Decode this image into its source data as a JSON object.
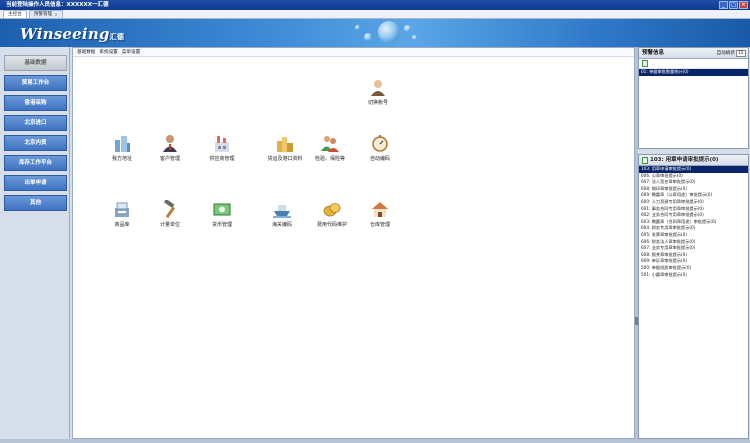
{
  "window": {
    "title": "当前登陆操作人员信息：XXXXXX一汇德"
  },
  "tabs": [
    {
      "label": "主控台",
      "active": true,
      "closable": false
    },
    {
      "label": "预警管理",
      "active": false,
      "closable": true
    }
  ],
  "brand": {
    "logo_text": "Winseeing",
    "logo_suffix": "汇德"
  },
  "sidebar": {
    "items": [
      {
        "label": "基础数据",
        "style": "grey"
      },
      {
        "label": "贸易工作台",
        "style": "blue"
      },
      {
        "label": "香港采购",
        "style": "blue"
      },
      {
        "label": "北京进口",
        "style": "blue"
      },
      {
        "label": "北京内贸",
        "style": "blue"
      },
      {
        "label": "库存工作平台",
        "style": "blue"
      },
      {
        "label": "出单申请",
        "style": "blue"
      },
      {
        "label": "其他",
        "style": "blue"
      }
    ]
  },
  "main": {
    "menu": [
      "基础数据",
      "系统设置",
      "菜单设置"
    ],
    "functions": [
      {
        "label": "切换账号",
        "icon": "user-switch-icon",
        "color": "#c7a37a"
      },
      {
        "label": "我方地址",
        "icon": "buildings-icon",
        "color": "#6fa6d8"
      },
      {
        "label": "客户管理",
        "icon": "businessman-icon",
        "color": "#6a4f3a"
      },
      {
        "label": "供应商管理",
        "icon": "factory-icon",
        "color": "#d87060"
      },
      {
        "label": "货运及港口资料",
        "icon": "city-icon",
        "color": "#e0b050"
      },
      {
        "label": "检验、保险等",
        "icon": "people-icon",
        "color": "#3f9a4f"
      },
      {
        "label": "自动编码",
        "icon": "stopwatch-icon",
        "color": "#d9a060"
      },
      {
        "label": "商品库",
        "icon": "cash-register-icon",
        "color": "#8aa4c4"
      },
      {
        "label": "计量单位",
        "icon": "hammer-icon",
        "color": "#b8863a"
      },
      {
        "label": "货币管理",
        "icon": "banknote-icon",
        "color": "#3f9a4f"
      },
      {
        "label": "海关编码",
        "icon": "ship-icon",
        "color": "#4a7fb0"
      },
      {
        "label": "费用代码维护",
        "icon": "coins-icon",
        "color": "#e2b23a"
      },
      {
        "label": "仓库管理",
        "icon": "house-icon",
        "color": "#d07840"
      }
    ]
  },
  "warning_panel": {
    "title": "预警信息",
    "refresh_label": "自动刷新",
    "refresh_value": "15",
    "items": [
      "01: 单据审批数量统计(0)"
    ]
  },
  "approval_panel": {
    "title": "103: 用章申请审批提示(0)",
    "items": [
      "103: 用章申请审批提示(0)",
      "606: 公章审批提示(0)",
      "607: 法人签名章审批提示(0)",
      "608: 钢印章审批提示(0)",
      "609: 椭圆章（公章用途）审批提示(0)",
      "600: 人力资源专用章审批提示(0)",
      "601: 事务合同专用章审批提示(0)",
      "602: 业务合同专用章审批提示(0)",
      "603: 椭圆章（合同章用途）审批提示(0)",
      "604: 财务专用章审批提示(0)",
      "605: 发票章审批提示(0)",
      "606: 财务法人章审批提示(0)",
      "607: 业务专用章审批提示(0)",
      "608: 报关章审批提示(0)",
      "609: 单证章审批提示(0)",
      "500: 单据纸质审批提示(0)",
      "501: 小圆章审批提示(0)"
    ]
  }
}
